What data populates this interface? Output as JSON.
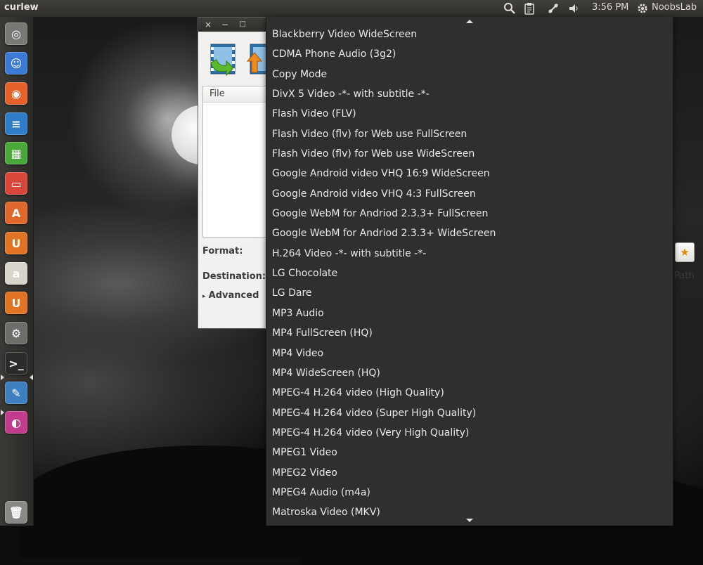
{
  "panel": {
    "app_title": "curlew",
    "clock": "3:56 PM",
    "user": "NoobsLab",
    "tray_icons": [
      "search-icon",
      "clipboard-indicator-icon",
      "network-icon",
      "volume-icon",
      "gear-icon"
    ]
  },
  "launcher": {
    "items": [
      {
        "name": "ubuntu-dash-icon",
        "color": "#7a7874",
        "glyph": "◎"
      },
      {
        "name": "finder-face-icon",
        "color": "#3b7bd6",
        "glyph": "☺"
      },
      {
        "name": "firefox-icon",
        "color": "#e5632b",
        "glyph": "◉"
      },
      {
        "name": "writer-document-icon",
        "color": "#2f7dc7",
        "glyph": "≡"
      },
      {
        "name": "calc-spreadsheet-icon",
        "color": "#4aa83a",
        "glyph": "▦"
      },
      {
        "name": "impress-presentation-icon",
        "color": "#d9473a",
        "glyph": "▭"
      },
      {
        "name": "software-center-icon",
        "color": "#e0682d",
        "glyph": "A"
      },
      {
        "name": "ubuntu-one-icon",
        "color": "#e17323",
        "glyph": "U"
      },
      {
        "name": "amazon-icon",
        "color": "#d8d4cc",
        "glyph": "a"
      },
      {
        "name": "ubuntu-one-music-icon",
        "color": "#e17323",
        "glyph": "U"
      },
      {
        "name": "system-settings-icon",
        "color": "#6f6d69",
        "glyph": "⚙"
      },
      {
        "name": "terminal-icon",
        "color": "#2b2b2b",
        "glyph": ">_"
      },
      {
        "name": "curlew-icon",
        "color": "#3e7fbf",
        "glyph": "✎"
      },
      {
        "name": "media-app-icon",
        "color": "#c23b8c",
        "glyph": "◐"
      },
      {
        "name": "trash-icon",
        "color": "#8a8884",
        "glyph": "🗑"
      }
    ]
  },
  "window": {
    "close": "×",
    "minimize": "−",
    "maximize": "□",
    "file_column": "File",
    "format_label": "Format:",
    "destination_label": "Destination:",
    "advanced_label": "Advanced",
    "path_label": "Path",
    "fav_icon": "★"
  },
  "format_menu": {
    "items": [
      "Blackberry Video WideScreen",
      "CDMA Phone Audio (3g2)",
      "Copy Mode",
      "DivX 5 Video -*- with subtitle -*-",
      "Flash Video (FLV)",
      "Flash Video (flv) for Web use FullScreen",
      "Flash Video (flv) for Web use WideScreen",
      "Google Android video VHQ 16:9 WideScreen",
      "Google Android video VHQ 4:3 FullScreen",
      "Google WebM for Andriod 2.3.3+ FullScreen",
      "Google WebM for Andriod 2.3.3+ WideScreen",
      "H.264 Video -*- with subtitle -*-",
      "LG Chocolate",
      "LG Dare",
      "MP3 Audio",
      "MP4 FullScreen (HQ)",
      "MP4 Video",
      "MP4 WideScreen (HQ)",
      "MPEG-4 H.264 video (High Quality)",
      "MPEG-4 H.264 video (Super High Quality)",
      "MPEG-4 H.264 video (Very High Quality)",
      "MPEG1 Video",
      "MPEG2 Video",
      "MPEG4 Audio (m4a)",
      "Matroska Video (MKV)"
    ]
  }
}
